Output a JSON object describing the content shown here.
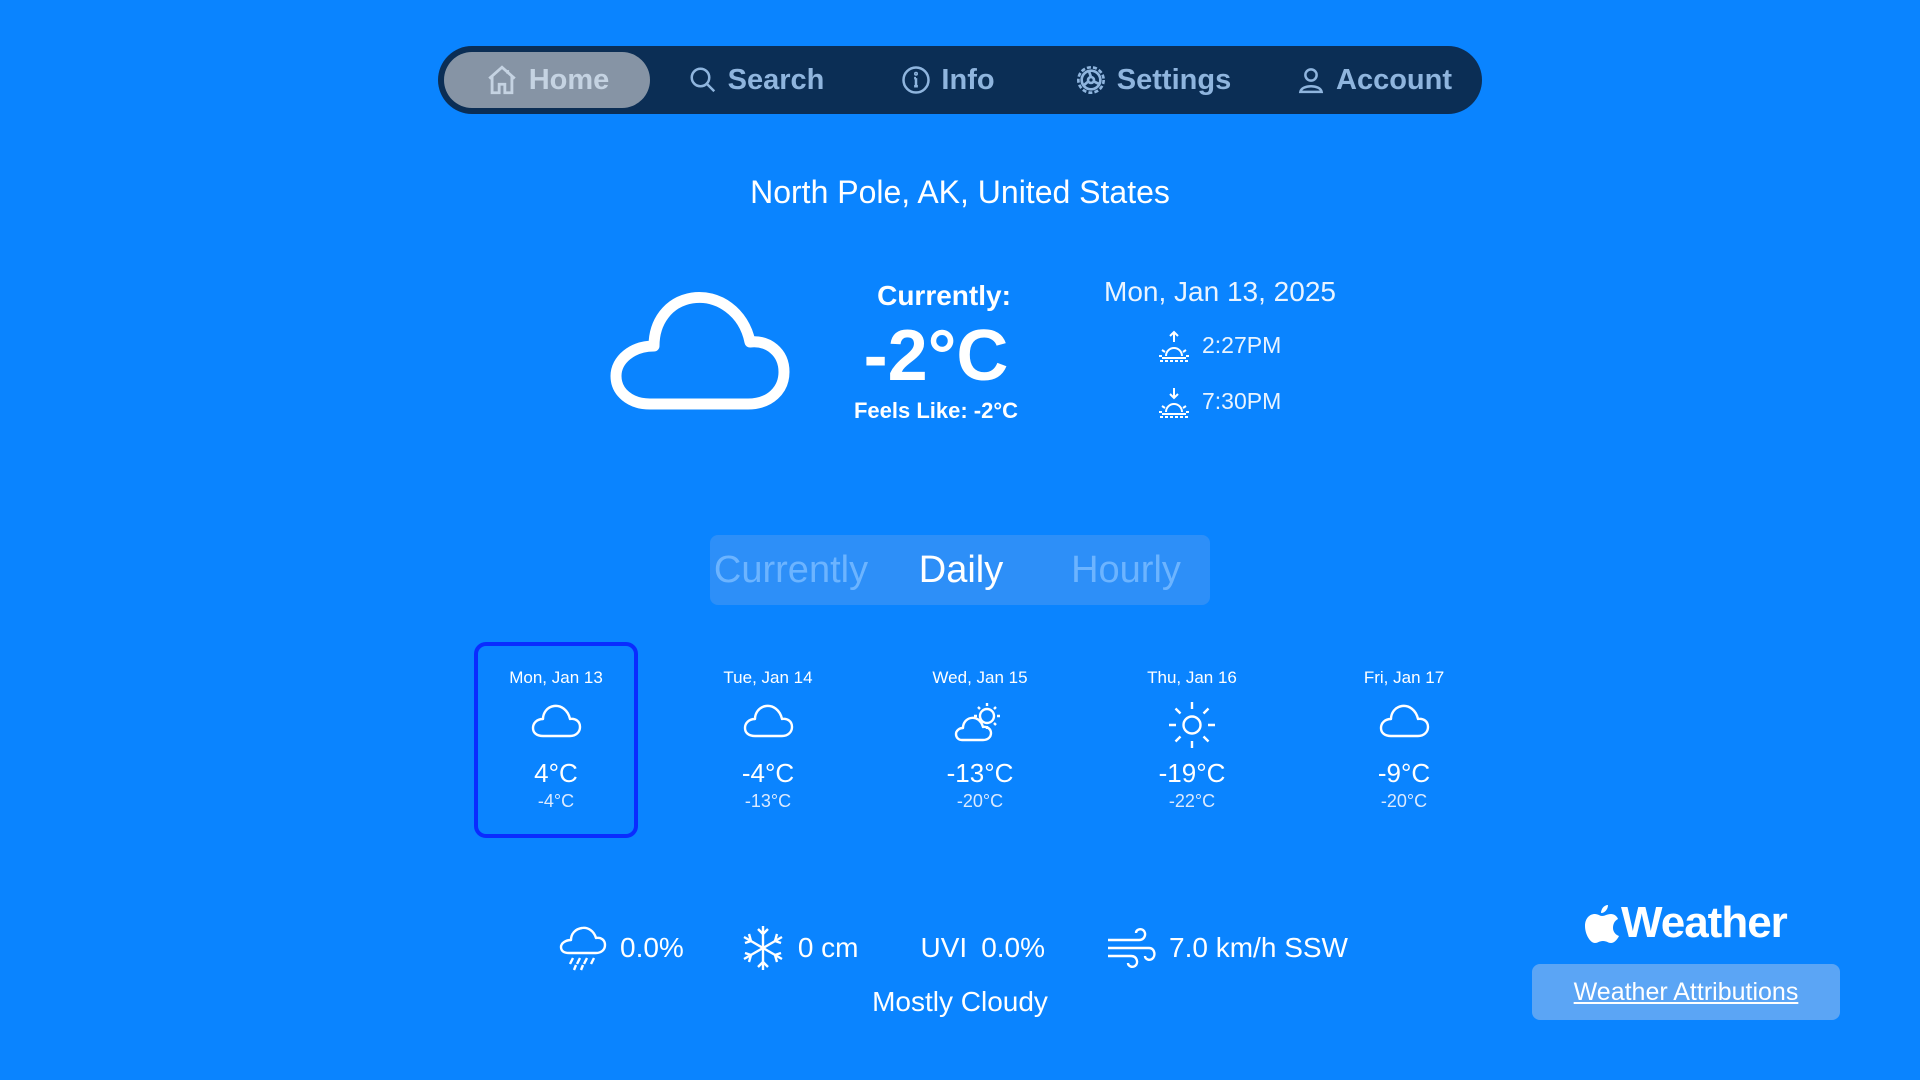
{
  "nav": {
    "items": [
      {
        "label": "Home",
        "icon": "home-icon",
        "active": true
      },
      {
        "label": "Search",
        "icon": "search-icon",
        "active": false
      },
      {
        "label": "Info",
        "icon": "info-icon",
        "active": false
      },
      {
        "label": "Settings",
        "icon": "gear-icon",
        "active": false
      },
      {
        "label": "Account",
        "icon": "person-icon",
        "active": false
      }
    ]
  },
  "location": "North Pole, AK, United States",
  "current": {
    "label": "Currently:",
    "temperature": "-2°C",
    "feels_like": "Feels Like: -2°C",
    "icon": "cloud-icon",
    "date": "Mon, Jan 13, 2025",
    "sunrise": "2:27PM",
    "sunset": "7:30PM"
  },
  "segments": {
    "items": [
      "Currently",
      "Daily",
      "Hourly"
    ],
    "selected": "Daily"
  },
  "daily": [
    {
      "day": "Mon, Jan 13",
      "icon": "cloud-icon",
      "high": "4°C",
      "low": "-4°C",
      "selected": true
    },
    {
      "day": "Tue, Jan 14",
      "icon": "cloud-icon",
      "high": "-4°C",
      "low": "-13°C",
      "selected": false
    },
    {
      "day": "Wed, Jan 15",
      "icon": "partly-cloudy-icon",
      "high": "-13°C",
      "low": "-20°C",
      "selected": false
    },
    {
      "day": "Thu, Jan 16",
      "icon": "sun-icon",
      "high": "-19°C",
      "low": "-22°C",
      "selected": false
    },
    {
      "day": "Fri, Jan 17",
      "icon": "cloud-icon",
      "high": "-9°C",
      "low": "-20°C",
      "selected": false
    }
  ],
  "stats": {
    "precipitation": "0.0%",
    "snow": "0 cm",
    "uvi_label": "UVI",
    "uvi_value": "0.0%",
    "wind": "7.0 km/h SSW"
  },
  "condition": "Mostly Cloudy",
  "attribution": {
    "brand": "Weather",
    "link_label": "Weather Attributions"
  },
  "colors": {
    "background": "#0a84ff",
    "nav_background": "#0b2e55",
    "nav_active": "#8694a5",
    "selected_border": "#0a2cff",
    "attribution_button": "#5ba5f5"
  }
}
